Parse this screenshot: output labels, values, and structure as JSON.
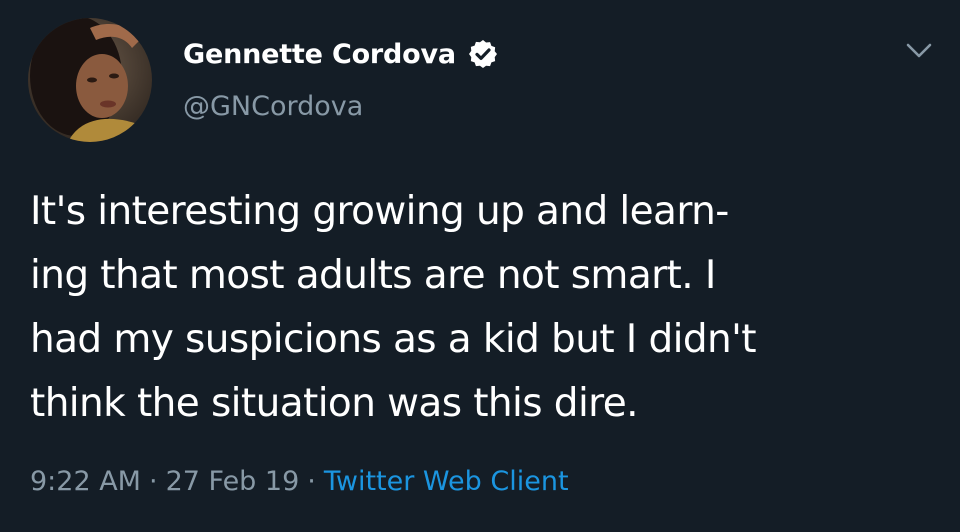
{
  "author": {
    "display_name": "Gennette Cordova",
    "handle": "@GNCordova",
    "verified": true,
    "avatar_icon": "profile-photo"
  },
  "tweet": {
    "lines": [
      "It's interesting growing up and learn-",
      "ing that most adults are not smart. I",
      "had my suspicions as a kid but I didn't",
      "think the situation was this dire."
    ]
  },
  "meta": {
    "time": "9:22 AM",
    "separator": "·",
    "date": "27 Feb 19",
    "client": "Twitter Web Client"
  },
  "colors": {
    "background": "#141d26",
    "primary_text": "#ffffff",
    "secondary_text": "#8899a6",
    "link": "#1b95e0"
  },
  "icons": {
    "verified": "verified-badge-icon",
    "menu": "chevron-down-icon"
  }
}
